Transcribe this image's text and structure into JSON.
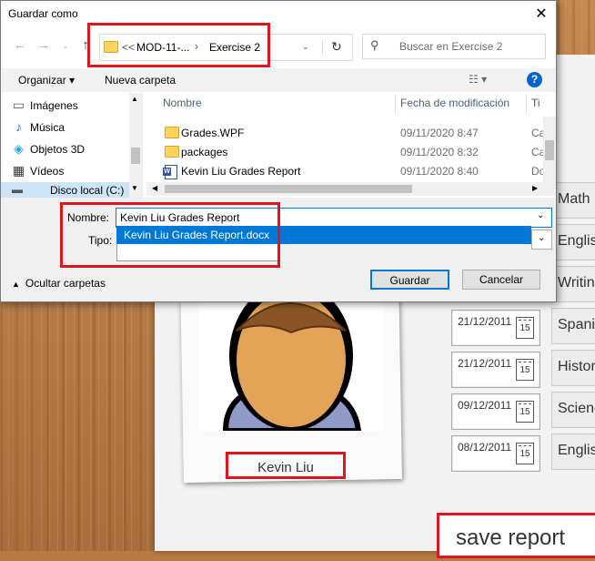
{
  "dialog": {
    "title": "Guardar como",
    "close": "✕",
    "breadcrumb": {
      "overflow": "<<",
      "segment1": "MOD-11-...",
      "separator": "›",
      "segment2": "Exercise 2"
    },
    "search_placeholder": "Buscar en Exercise 2",
    "toolbar": {
      "organize": "Organizar",
      "new_folder": "Nueva carpeta"
    },
    "nav_items": [
      {
        "label": "Imágenes",
        "icon": "pictures-icon"
      },
      {
        "label": "Música",
        "icon": "music-icon"
      },
      {
        "label": "Objetos 3D",
        "icon": "3d-objects-icon"
      },
      {
        "label": "Vídeos",
        "icon": "videos-icon"
      },
      {
        "label": "Disco local (C:)",
        "icon": "local-disk-icon"
      }
    ],
    "columns": {
      "name": "Nombre",
      "modified": "Fecha de modificación",
      "type": "Ti"
    },
    "files": [
      {
        "name": "Grades.WPF",
        "modified": "09/11/2020 8:47",
        "type": "Ca",
        "icon": "folder-icon"
      },
      {
        "name": "packages",
        "modified": "09/11/2020 8:32",
        "type": "Ca",
        "icon": "folder-icon"
      },
      {
        "name": "Kevin Liu Grades Report",
        "modified": "09/11/2020 8:40",
        "type": "Do",
        "icon": "word-doc-icon"
      }
    ],
    "filename_label": "Nombre:",
    "filename_value": "Kevin Liu Grades Report",
    "autocomplete": "Kevin Liu Grades Report.docx",
    "type_label": "Tipo:",
    "hide_folders": "Ocultar carpetas",
    "save": "Guardar",
    "cancel": "Cancelar"
  },
  "app": {
    "student_name": "Kevin Liu",
    "dates": [
      "21/12/2011",
      "21/12/2011",
      "09/12/2011",
      "08/12/2011"
    ],
    "calendar_day": "15",
    "subjects": [
      "Math",
      "Englis",
      "Writin",
      "Spanis",
      "Histor",
      "Scienc",
      "English"
    ],
    "save_report": "save report"
  },
  "colors": {
    "accent": "#0078d7",
    "highlight": "#e0141e"
  }
}
